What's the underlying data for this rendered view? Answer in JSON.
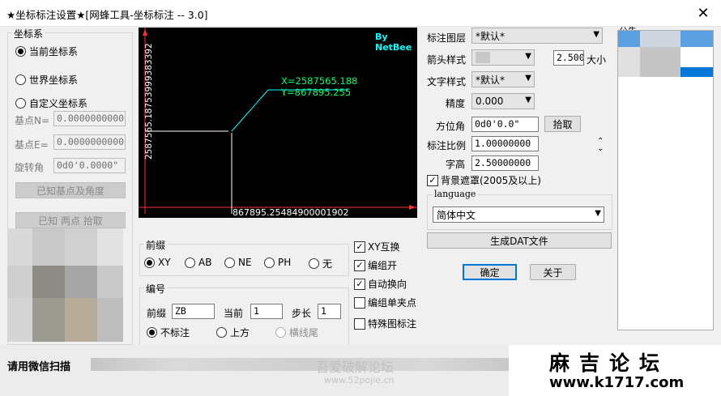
{
  "window": {
    "title": "★坐标标注设置★[网蜂工具-坐标标注 -- 3.0]",
    "close_glyph": "✕"
  },
  "coord_system": {
    "group_label": "坐标系",
    "current": "当前坐标系",
    "world": "世界坐标系",
    "custom": "自定义坐标系",
    "base_n_label": "基点N=",
    "base_n_value": "0.000000000000",
    "base_e_label": "基点E=",
    "base_e_value": "0.000000000000",
    "rotation_label": "旋转角",
    "rotation_value": "0d0'0.0000\"",
    "known_base_btn": "已知基点及角度",
    "known_two_btn": "已知 两点 拾取"
  },
  "preview": {
    "brand": "By NetBee",
    "x_text": "X=2587565.188",
    "y_text": "Y=867895.255",
    "vertical_axis_text": "2587565.18753999383392",
    "horizontal_axis_text": "867895.25484900001902"
  },
  "prefix": {
    "group_label": "前缀",
    "options": [
      "XY",
      "AB",
      "NE",
      "PH",
      "无"
    ]
  },
  "numbering": {
    "group_label": "编号",
    "prefix_label": "前缀",
    "prefix_value": "ZB",
    "current_label": "当前",
    "current_value": "1",
    "step_label": "步长",
    "step_value": "1",
    "no_label": "不标注",
    "above": "上方",
    "underline_tail": "横线尾"
  },
  "checks": {
    "xy_swap": "XY互换",
    "group_on": "编组开",
    "auto_wrap": "自动换向",
    "group_single_clip": "编组单夹点",
    "special_mark": "特殊图标注"
  },
  "settings": {
    "layer_label": "标注图层",
    "layer_value": "*默认*",
    "arrow_label": "箭头样式",
    "arrow_size": "2.5000",
    "size_label": "大小",
    "text_style_label": "文字样式",
    "text_style_value": "*默认*",
    "precision_label": "精度",
    "precision_value": "0.000",
    "azimuth_label": "方位角",
    "azimuth_value": "0d0'0.0\"",
    "pick_btn": "拾取",
    "scale_label": "标注比例",
    "scale_value": "1.00000000",
    "height_label": "字高",
    "height_value": "2.50000000",
    "bg_mask": "背景遮罩(2005及以上)",
    "language_label": "language",
    "language_value": "简体中文",
    "gen_dat_btn": "生成DAT文件",
    "ok_btn": "确定",
    "about_btn": "关于"
  },
  "right_panel": {
    "partial_label": "公告"
  },
  "footer": {
    "left_text": "请用微信扫描",
    "watermark_cn": "吾爱破解论坛",
    "watermark_url": "www.52pojie.cn",
    "badge_title": "麻吉论坛",
    "badge_url": "www.k1717.com"
  },
  "colors": {
    "accent_blue": "#0078d7",
    "preview_cyan": "#00ffff",
    "preview_red": "#ff3030"
  }
}
